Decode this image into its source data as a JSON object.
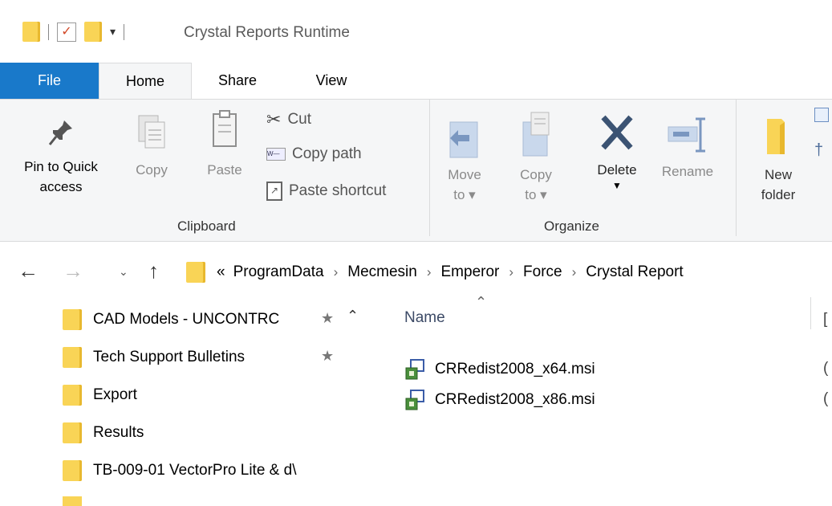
{
  "window": {
    "title": "Crystal Reports Runtime"
  },
  "quick_access_toolbar": {
    "icons": [
      "folder-icon",
      "properties-check-icon",
      "new-folder-icon",
      "customize-dropdown-icon"
    ]
  },
  "tabs": [
    {
      "label": "File",
      "active": false
    },
    {
      "label": "Home",
      "active": true
    },
    {
      "label": "Share",
      "active": false
    },
    {
      "label": "View",
      "active": false
    }
  ],
  "ribbon": {
    "clipboard": {
      "pin_line1": "Pin to Quick",
      "pin_line2": "access",
      "copy": "Copy",
      "paste": "Paste",
      "cut": "Cut",
      "copy_path": "Copy path",
      "paste_shortcut": "Paste shortcut",
      "group_label": "Clipboard"
    },
    "organize": {
      "move_line1": "Move",
      "move_line2": "to",
      "copy_line1": "Copy",
      "copy_line2": "to",
      "delete": "Delete",
      "rename": "Rename",
      "group_label": "Organize"
    },
    "new": {
      "new_folder_line1": "New",
      "new_folder_line2": "folder"
    }
  },
  "address_bar": {
    "overflow": "«",
    "crumbs": [
      "ProgramData",
      "Mecmesin",
      "Emperor",
      "Force",
      "Crystal Report"
    ]
  },
  "navigation_pane": {
    "items": [
      {
        "label": "CAD Models - UNCONTRC",
        "pinned": true
      },
      {
        "label": "Tech Support Bulletins",
        "pinned": true
      },
      {
        "label": "Export",
        "pinned": false
      },
      {
        "label": "Results",
        "pinned": false
      },
      {
        "label": "TB-009-01 VectorPro Lite & d\\",
        "pinned": false
      }
    ]
  },
  "file_list": {
    "column_name": "Name",
    "column_next_fragment": "[",
    "files": [
      {
        "name": "CRRedist2008_x64.msi",
        "next_col_fragment": "("
      },
      {
        "name": "CRRedist2008_x86.msi",
        "next_col_fragment": "("
      }
    ]
  },
  "colors": {
    "file_tab": "#1979ca",
    "folder": "#f9d456",
    "ribbon_bg": "#f5f6f7"
  }
}
